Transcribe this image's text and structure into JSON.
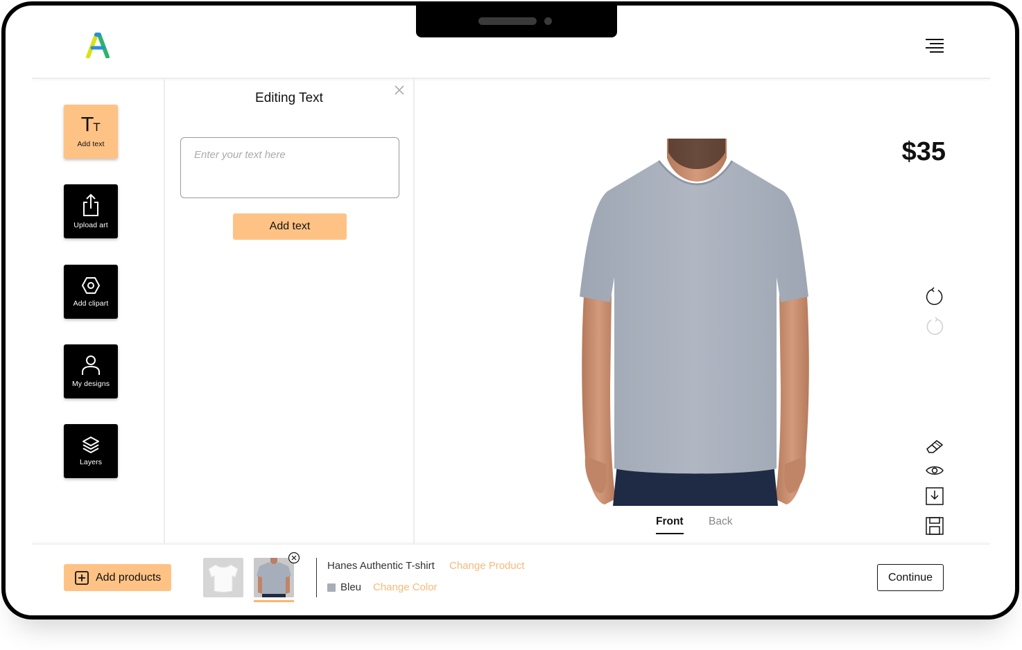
{
  "header": {
    "logo_icon": "brand-a-logo-icon",
    "menu_icon": "hamburger-menu-icon"
  },
  "tools": [
    {
      "label": "Add text",
      "icon": "text-tt-icon",
      "active": true
    },
    {
      "label": "Upload art",
      "icon": "upload-share-icon",
      "active": false
    },
    {
      "label": "Add clipart",
      "icon": "hexagon-clipart-icon",
      "active": false
    },
    {
      "label": "My designs",
      "icon": "user-icon",
      "active": false
    },
    {
      "label": "Layers",
      "icon": "layers-icon",
      "active": false
    }
  ],
  "panel": {
    "title": "Editing Text",
    "input_placeholder": "Enter your text here",
    "input_value": "",
    "add_button_label": "Add text",
    "close_icon": "close-icon"
  },
  "canvas": {
    "price": "$35",
    "shirt_color": "#aab1bf",
    "views": [
      {
        "label": "Front",
        "active": true
      },
      {
        "label": "Back",
        "active": false
      }
    ],
    "side_tools": [
      "undo-icon",
      "redo-icon",
      "eraser-icon",
      "preview-eye-icon",
      "download-icon",
      "save-icon"
    ]
  },
  "footer": {
    "add_products_label": "Add products",
    "product_name": "Hanes Authentic T-shirt",
    "change_product_label": "Change Product",
    "color_name": "Bleu",
    "color_swatch": "#a8adb7",
    "change_color_label": "Change Color",
    "continue_label": "Continue"
  },
  "colors": {
    "accent": "#ffc285",
    "accent_text": "#f7b878",
    "dark_tool": "#000000"
  }
}
